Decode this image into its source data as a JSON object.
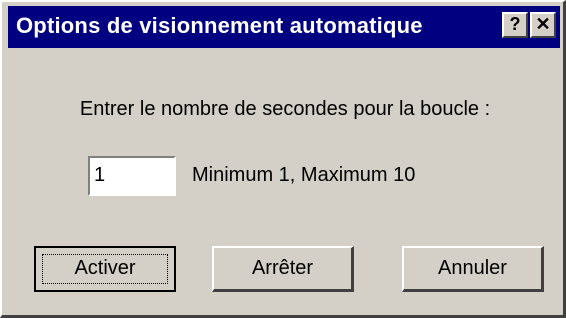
{
  "window": {
    "title": "Options de visionnement automatique",
    "help_button": "?",
    "close_button": "✕"
  },
  "prompt": "Entrer le nombre de secondes pour la boucle :",
  "seconds_input": {
    "value": "1"
  },
  "range_hint": "Minimum 1, Maximum 10",
  "buttons": {
    "activate": "Activer",
    "stop": "Arrêter",
    "cancel": "Annuler"
  }
}
